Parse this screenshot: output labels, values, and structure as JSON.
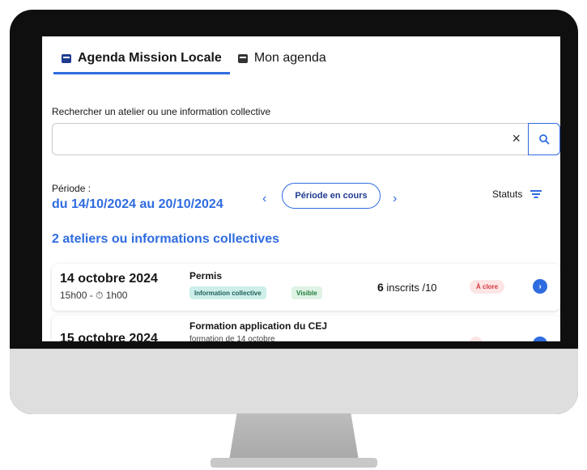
{
  "tabs": [
    {
      "label": "Agenda Mission Locale",
      "icon": "calendar-icon",
      "active": true
    },
    {
      "label": "Mon agenda",
      "icon": "calendar-icon",
      "active": false
    }
  ],
  "search": {
    "label": "Rechercher un atelier ou une information collective",
    "value": "",
    "placeholder": "",
    "clear_icon": "×",
    "button_icon": "search-icon"
  },
  "period": {
    "label": "Période :",
    "value": "du 14/10/2024 au 20/10/2024",
    "prev": "‹",
    "next": "›",
    "current_button": "Période en cours"
  },
  "statuts": {
    "label": "Statuts",
    "icon": "filter-icon"
  },
  "results": {
    "count_label": "2 ateliers ou informations collectives"
  },
  "events": [
    {
      "date": "14 octobre 2024",
      "time": "15h00 - ⏱ 1h00",
      "title": "Permis",
      "type_badge": "Information collective",
      "visibility_badge": "Visible",
      "inscrits_count": "6",
      "inscrits_rest": " inscrits /10",
      "status_badge": "À clore"
    },
    {
      "date": "15 octobre 2024",
      "title": "Formation application du CEJ",
      "subtitle": "formation de 14 octobre"
    }
  ],
  "colors": {
    "accent": "#2f6ce0",
    "navy": "#1f3b8f",
    "danger": "#d3373b"
  }
}
